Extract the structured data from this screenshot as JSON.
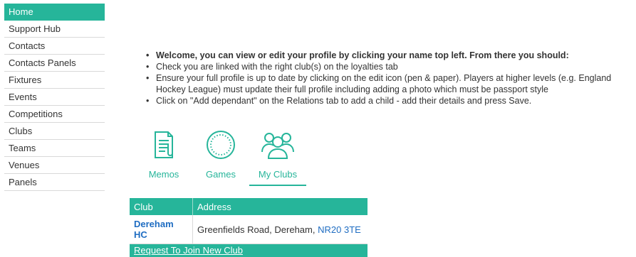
{
  "sidebar": {
    "items": [
      {
        "label": "Home"
      },
      {
        "label": "Support Hub"
      },
      {
        "label": "Contacts"
      },
      {
        "label": "Contacts Panels"
      },
      {
        "label": "Fixtures"
      },
      {
        "label": "Events"
      },
      {
        "label": "Competitions"
      },
      {
        "label": "Clubs"
      },
      {
        "label": "Teams"
      },
      {
        "label": "Venues"
      },
      {
        "label": "Panels"
      }
    ],
    "active": "Home"
  },
  "welcome": {
    "lines": [
      "Welcome, you can view or edit your profile by clicking your name top left. From there you should:",
      "Check you are linked with the right club(s) on the loyalties tab",
      "Ensure your full profile is up to date by clicking on the edit icon (pen & paper). Players at higher levels (e.g. England Hockey League) must update their full profile including adding a photo which must be passport style",
      "Click on \"Add dependant\" on the Relations tab to add a child - add their details and press Save."
    ]
  },
  "tiles": [
    {
      "label": "Memos",
      "icon": "memo-icon"
    },
    {
      "label": "Games",
      "icon": "ball-icon"
    },
    {
      "label": "My Clubs",
      "icon": "group-icon"
    }
  ],
  "active_tile": "My Clubs",
  "clubs_table": {
    "headers": [
      "Club",
      "Address"
    ],
    "rows": [
      {
        "club": "Dereham HC",
        "address_prefix": "Greenfields Road, Dereham,",
        "postcode": "NR20 3TE"
      }
    ],
    "join_link": "Request To Join New Club"
  },
  "colors": {
    "accent": "#26b59a",
    "link": "#1f6dc2"
  }
}
